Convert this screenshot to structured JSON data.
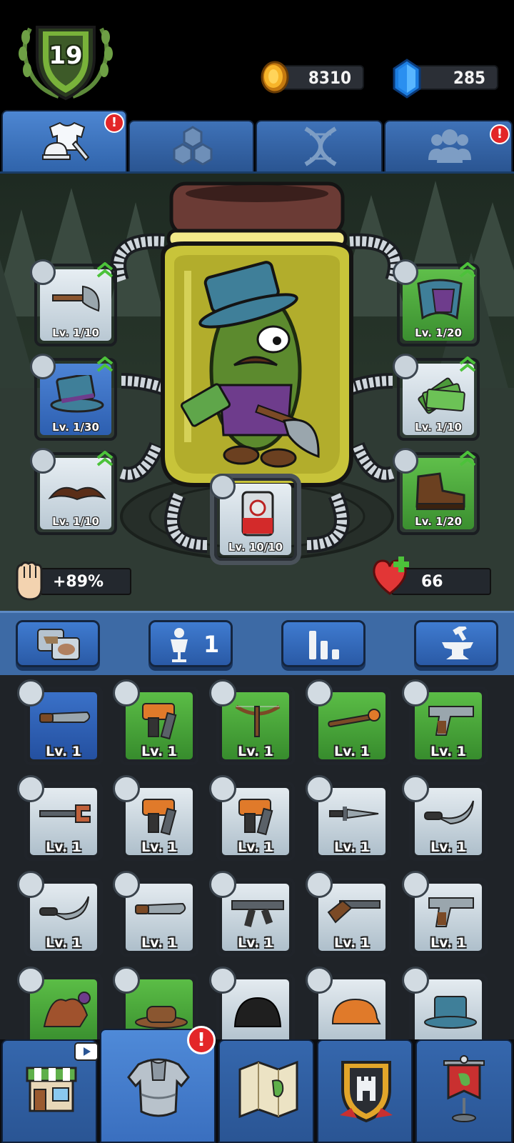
{
  "player": {
    "level": "19"
  },
  "currency": {
    "coins": "8310",
    "gems": "285"
  },
  "colors": {
    "tab_blue": "#3f72b8",
    "rarity_green": "#4aa83a",
    "rarity_blue": "#3a71c8",
    "rarity_grey": "#c9d6df",
    "alert_red": "#e32628"
  },
  "tabs": [
    {
      "name": "equipment-tab",
      "icon": "shirt-helmet-icon",
      "alert": "!"
    },
    {
      "name": "gems-tab",
      "icon": "hexagon-gems-icon",
      "alert": ""
    },
    {
      "name": "dna-tab",
      "icon": "dna-icon",
      "alert": ""
    },
    {
      "name": "friends-tab",
      "icon": "people-icon",
      "alert": "!"
    }
  ],
  "equipped": {
    "weapon": {
      "level": "Lv. 1/10",
      "rarity": "grey",
      "icon": "axe-icon"
    },
    "hat": {
      "level": "Lv. 1/30",
      "rarity": "blue",
      "icon": "top-hat-icon"
    },
    "face": {
      "level": "Lv. 1/10",
      "rarity": "grey",
      "icon": "mustache-icon"
    },
    "body": {
      "level": "Lv. 1/20",
      "rarity": "green",
      "icon": "cape-icon"
    },
    "offhand": {
      "level": "Lv. 1/10",
      "rarity": "grey",
      "icon": "money-icon"
    },
    "shoes": {
      "level": "Lv. 1/20",
      "rarity": "green",
      "icon": "boot-icon"
    },
    "consumable": {
      "level": "Lv. 10/10",
      "rarity": "grey",
      "icon": "can-icon"
    }
  },
  "stats": {
    "attack_bonus": "+89%",
    "health": "66"
  },
  "actions": {
    "merge_count": "1"
  },
  "inventory": [
    {
      "level": "Lv. 1",
      "rarity": "blue",
      "icon": "combat-knife-icon"
    },
    {
      "level": "Lv. 1",
      "rarity": "green",
      "icon": "nail-gun-icon"
    },
    {
      "level": "Lv. 1",
      "rarity": "green",
      "icon": "crossbow-icon"
    },
    {
      "level": "Lv. 1",
      "rarity": "green",
      "icon": "staff-icon"
    },
    {
      "level": "Lv. 1",
      "rarity": "green",
      "icon": "pistol-icon"
    },
    {
      "level": "Lv. 1",
      "rarity": "grey",
      "icon": "wrench-icon"
    },
    {
      "level": "Lv. 1",
      "rarity": "grey",
      "icon": "nail-gun-icon"
    },
    {
      "level": "Lv. 1",
      "rarity": "grey",
      "icon": "nail-gun-icon"
    },
    {
      "level": "Lv. 1",
      "rarity": "grey",
      "icon": "dagger-icon"
    },
    {
      "level": "Lv. 1",
      "rarity": "grey",
      "icon": "karambit-icon"
    },
    {
      "level": "Lv. 1",
      "rarity": "grey",
      "icon": "karambit-icon"
    },
    {
      "level": "Lv. 1",
      "rarity": "grey",
      "icon": "combat-knife-icon"
    },
    {
      "level": "Lv. 1",
      "rarity": "grey",
      "icon": "assault-rifle-icon"
    },
    {
      "level": "Lv. 1",
      "rarity": "grey",
      "icon": "shotgun-icon"
    },
    {
      "level": "Lv. 1",
      "rarity": "grey",
      "icon": "pistol-icon"
    },
    {
      "level": "",
      "rarity": "green",
      "icon": "jester-hat-icon"
    },
    {
      "level": "",
      "rarity": "green",
      "icon": "cowboy-hat-icon"
    },
    {
      "level": "",
      "rarity": "grey",
      "icon": "hair-icon"
    },
    {
      "level": "",
      "rarity": "grey",
      "icon": "cap-icon"
    },
    {
      "level": "",
      "rarity": "grey",
      "icon": "top-hat-icon"
    }
  ],
  "bottom_nav": [
    {
      "name": "nav-shop",
      "icon": "shop-icon",
      "alert": ""
    },
    {
      "name": "nav-equipment",
      "icon": "armor-icon",
      "alert": "!"
    },
    {
      "name": "nav-map",
      "icon": "map-icon",
      "alert": ""
    },
    {
      "name": "nav-clan",
      "icon": "shield-tower-icon",
      "alert": ""
    },
    {
      "name": "nav-events",
      "icon": "banner-icon",
      "alert": ""
    }
  ]
}
